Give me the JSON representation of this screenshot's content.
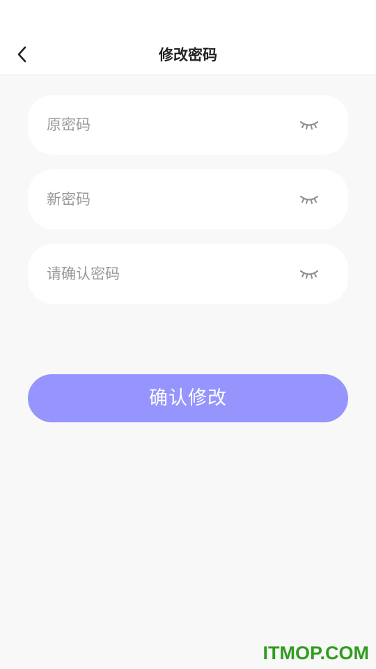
{
  "header": {
    "title": "修改密码",
    "back_icon": "chevron-left-icon"
  },
  "form": {
    "old_password": {
      "placeholder": "原密码",
      "value": "",
      "toggle_icon": "eye-closed-icon"
    },
    "new_password": {
      "placeholder": "新密码",
      "value": "",
      "toggle_icon": "eye-closed-icon"
    },
    "confirm_password": {
      "placeholder": "请确认密码",
      "value": "",
      "toggle_icon": "eye-closed-icon"
    }
  },
  "submit": {
    "label": "确认修改",
    "color": "#9595fd"
  },
  "watermark": {
    "text": "ITMOP.COM",
    "color": "#2f9c1f"
  },
  "colors": {
    "page_background": "#f8f8f8",
    "header_background": "#ffffff",
    "placeholder_text": "#9a9a9a"
  }
}
